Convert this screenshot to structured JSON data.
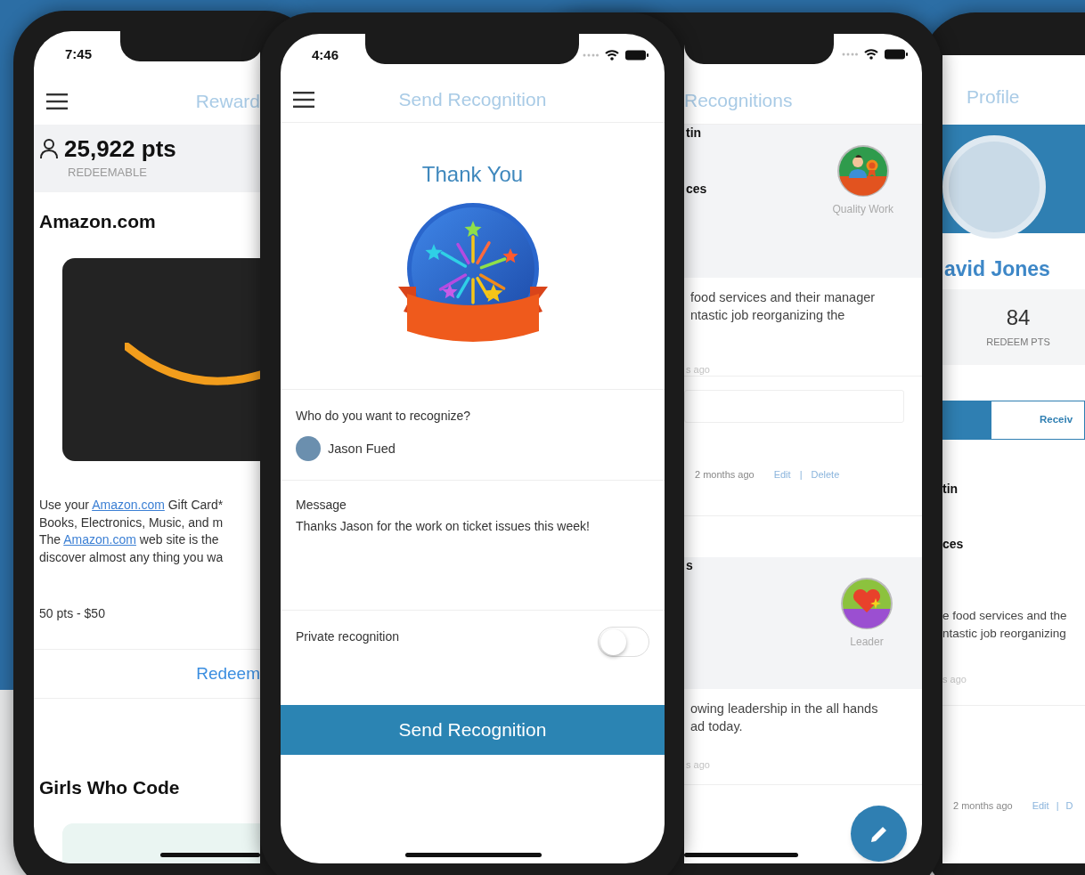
{
  "rewards_screen": {
    "time": "7:45",
    "title": "Reward",
    "points": "25,922 pts",
    "points_label": "REDEEMABLE",
    "items": [
      {
        "name": "Amazon.com",
        "description_lines": [
          [
            {
              "text": "Use your ",
              "link": false
            },
            {
              "text": "Amazon.com",
              "link": true
            },
            {
              "text": " Gift Card*",
              "link": false
            }
          ],
          [
            {
              "text": "Books, Electronics, Music, and m",
              "link": false
            }
          ],
          [
            {
              "text": "The ",
              "link": false
            },
            {
              "text": "Amazon.com",
              "link": true
            },
            {
              "text": " web site is the",
              "link": false
            }
          ],
          [
            {
              "text": "discover almost any thing you wa",
              "link": false
            }
          ]
        ],
        "price": "50 pts - $50",
        "action": "Redeem"
      },
      {
        "name": "Girls Who Code"
      }
    ]
  },
  "send_screen": {
    "time": "4:46",
    "title": "Send Recognition",
    "heading": "Thank You",
    "recipient_label": "Who do you want to recognize?",
    "recipient": "Jason Fued",
    "message_label": "Message",
    "message": "Thanks Jason for the work on ticket issues this week!",
    "private_label": "Private recognition",
    "private_on": false,
    "submit": "Send Recognition"
  },
  "recognitions_screen": {
    "title": "Recognitions",
    "posts": [
      {
        "names": [
          "tin",
          "ces"
        ],
        "badge": "Quality Work",
        "kind": "quality",
        "message_lines": [
          "food services and their manager",
          "ntastic job reorganizing the"
        ],
        "time": "s ago",
        "comment_box": true,
        "footer": {
          "time": "2 months ago",
          "edit": "Edit",
          "separator": "|",
          "delete": "Delete"
        }
      },
      {
        "names": [
          "s"
        ],
        "badge": "Leader",
        "kind": "heart",
        "message_lines": [
          "owing leadership in the all hands",
          "ad today."
        ],
        "time": "s ago",
        "comment_box": false
      }
    ]
  },
  "profile_screen": {
    "title": "Profile",
    "name": "avid Jones",
    "stat_value": "84",
    "stat_label": "REDEEM PTS",
    "tabs": [
      {
        "selected": true
      },
      {
        "label": "Receiv",
        "selected": false
      }
    ],
    "post": {
      "names": [
        "tin",
        "ces"
      ],
      "message_lines": [
        "e food services and the",
        "ntastic job reorganizing"
      ],
      "time": "s ago"
    },
    "footer": {
      "time": "2 months ago",
      "edit": "Edit",
      "separator": "|",
      "delete": "D"
    }
  }
}
